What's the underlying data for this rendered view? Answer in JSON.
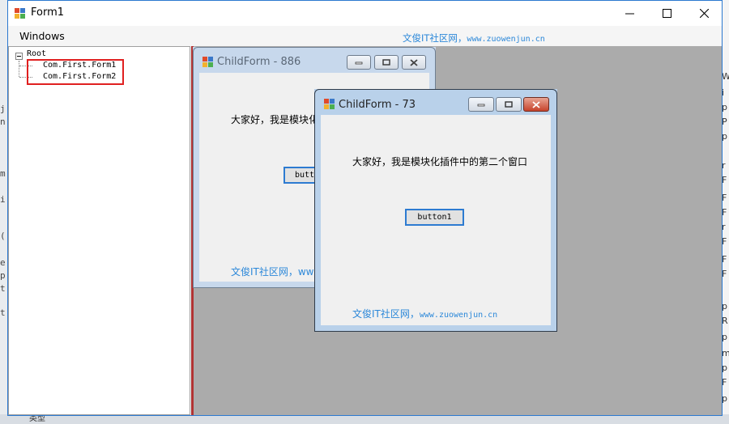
{
  "main_window": {
    "title": "Form1",
    "menu": {
      "windows_label": "Windows"
    },
    "watermark": {
      "site_cn": "文俊IT社区网，",
      "site_url": "www.zuowenjun.cn"
    },
    "caption_buttons": {
      "minimize_icon": "minimize-icon",
      "maximize_icon": "maximize-icon",
      "close_icon": "close-icon"
    }
  },
  "tree": {
    "root_label": "Root",
    "items": [
      {
        "label": "Com.First.Form1"
      },
      {
        "label": "Com.First.Form2"
      }
    ],
    "highlight_color": "#e02020"
  },
  "child_form_back": {
    "title": "ChildForm - 886",
    "label_visible": "大家好，我是模块化",
    "button_visible": "butt",
    "watermark_visible": "文俊IT社区网，www"
  },
  "child_form_front": {
    "title": "ChildForm - 73",
    "label": "大家好，我是模块化插件中的第二个窗口",
    "button": "button1",
    "watermark_cn": "文俊IT社区网，",
    "watermark_url": "www.zuowenjun.cn"
  },
  "background": {
    "bottom_bar_text": "类型"
  },
  "colors": {
    "accent_blue": "#2c88d9",
    "window_border": "#2b79d0",
    "mdi_background": "#ababab",
    "close_red": "#c7432b"
  }
}
